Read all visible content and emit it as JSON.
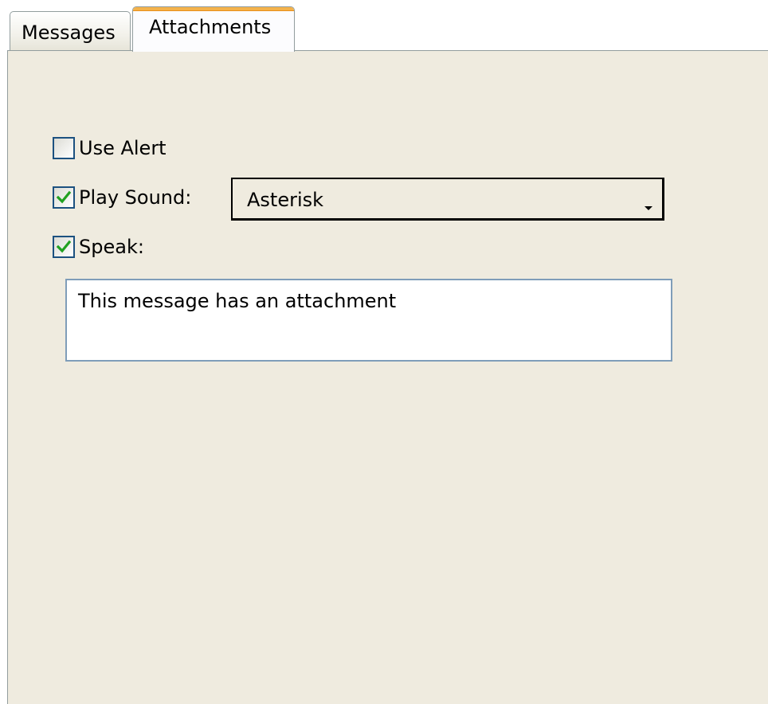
{
  "tabs": [
    {
      "label": "Messages",
      "selected": false
    },
    {
      "label": "Attachments",
      "selected": true
    }
  ],
  "options": {
    "use_alert": {
      "label": "Use Alert",
      "checked": false
    },
    "play_sound": {
      "label": "Play Sound:",
      "checked": true,
      "selected_sound": "Asterisk"
    },
    "speak": {
      "label": "Speak:",
      "checked": true,
      "text": "This message has an attachment"
    }
  },
  "icons": {
    "check": "check-icon",
    "dropdown": "chevron-down-icon"
  },
  "colors": {
    "panel_background": "#efebdf",
    "active_tab_highlight": "#f4b24a",
    "checkbox_border": "#1c5180",
    "checkmark": "#21a121",
    "textarea_border": "#7f9db9"
  }
}
